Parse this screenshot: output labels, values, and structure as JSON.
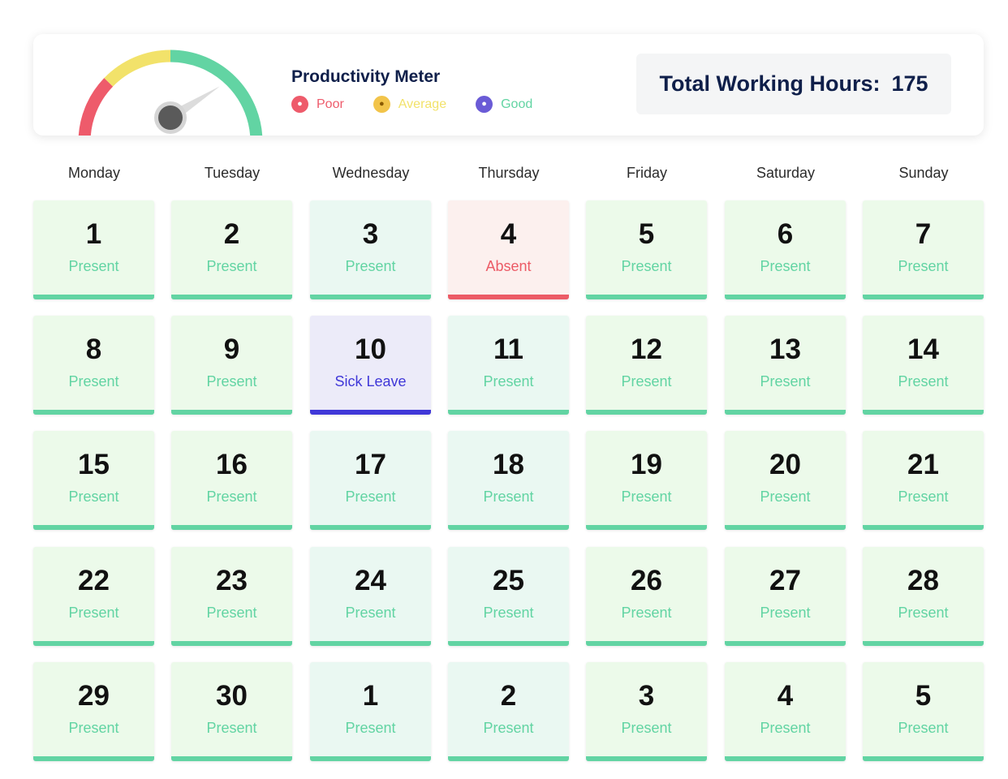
{
  "meter": {
    "title": "Productivity Meter",
    "level": 0.82,
    "colors": {
      "poor": "#ee5b6b",
      "average": "#f2e26a",
      "good": "#62d4a3"
    },
    "legend": [
      {
        "label": "Poor",
        "icon": "poor-emoji-icon",
        "color": "#ee5b6b"
      },
      {
        "label": "Average",
        "icon": "average-emoji-icon",
        "color": "#f2e26a"
      },
      {
        "label": "Good",
        "icon": "good-emoji-icon",
        "color": "#62d4a3"
      }
    ]
  },
  "summary": {
    "label": "Total Working Hours:",
    "value": "175"
  },
  "weekdays": [
    "Monday",
    "Tuesday",
    "Wednesday",
    "Thursday",
    "Friday",
    "Saturday",
    "Sunday"
  ],
  "status_colors": {
    "Present": {
      "text": "#62d4a3",
      "bar": "#62d4a3",
      "bg": "#ecfaea",
      "bg_alt": "#eaf8f2"
    },
    "Absent": {
      "text": "#ec5b66",
      "bar": "#ec5b66",
      "bg": "#fcf0ee"
    },
    "Sick Leave": {
      "text": "#4038d8",
      "bar": "#4038d8",
      "bg": "#ecebf9"
    }
  },
  "days": [
    {
      "day": "1",
      "status": "Present"
    },
    {
      "day": "2",
      "status": "Present"
    },
    {
      "day": "3",
      "status": "Present"
    },
    {
      "day": "4",
      "status": "Absent"
    },
    {
      "day": "5",
      "status": "Present"
    },
    {
      "day": "6",
      "status": "Present"
    },
    {
      "day": "7",
      "status": "Present"
    },
    {
      "day": "8",
      "status": "Present"
    },
    {
      "day": "9",
      "status": "Present"
    },
    {
      "day": "10",
      "status": "Sick Leave"
    },
    {
      "day": "11",
      "status": "Present"
    },
    {
      "day": "12",
      "status": "Present"
    },
    {
      "day": "13",
      "status": "Present"
    },
    {
      "day": "14",
      "status": "Present"
    },
    {
      "day": "15",
      "status": "Present"
    },
    {
      "day": "16",
      "status": "Present"
    },
    {
      "day": "17",
      "status": "Present"
    },
    {
      "day": "18",
      "status": "Present"
    },
    {
      "day": "19",
      "status": "Present"
    },
    {
      "day": "20",
      "status": "Present"
    },
    {
      "day": "21",
      "status": "Present"
    },
    {
      "day": "22",
      "status": "Present"
    },
    {
      "day": "23",
      "status": "Present"
    },
    {
      "day": "24",
      "status": "Present"
    },
    {
      "day": "25",
      "status": "Present"
    },
    {
      "day": "26",
      "status": "Present"
    },
    {
      "day": "27",
      "status": "Present"
    },
    {
      "day": "28",
      "status": "Present"
    },
    {
      "day": "29",
      "status": "Present"
    },
    {
      "day": "30",
      "status": "Present"
    },
    {
      "day": "1",
      "status": "Present"
    },
    {
      "day": "2",
      "status": "Present"
    },
    {
      "day": "3",
      "status": "Present"
    },
    {
      "day": "4",
      "status": "Present"
    },
    {
      "day": "5",
      "status": "Present"
    }
  ]
}
